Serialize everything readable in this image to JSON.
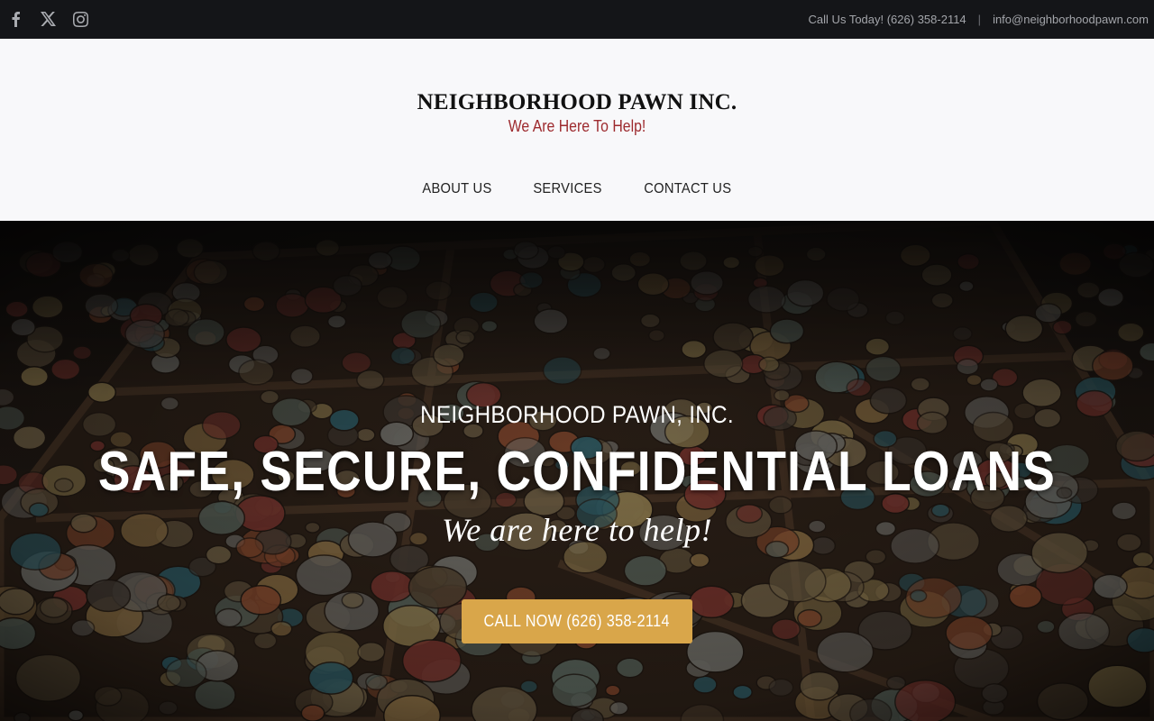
{
  "topbar": {
    "social": [
      {
        "name": "facebook-icon"
      },
      {
        "name": "x-twitter-icon"
      },
      {
        "name": "instagram-icon"
      }
    ],
    "phone_text": "Call Us Today! (626) 358-2114",
    "separator": "|",
    "email": "info@neighborhoodpawn.com"
  },
  "header": {
    "logo_name": "NEIGHBORHOOD PAWN INC.",
    "logo_tagline": "We Are Here To Help!",
    "nav": [
      "ABOUT US",
      "SERVICES",
      "CONTACT US"
    ]
  },
  "hero": {
    "eyebrow": "NEIGHBORHOOD PAWN, INC.",
    "headline": "SAFE, SECURE, CONFIDENTIAL LOANS",
    "subline": "We are here to help!",
    "cta_label": "CALL NOW (626) 358-2114",
    "colors": {
      "cta": "#d9a64a",
      "tagline": "#9d2a2e",
      "topbar": "#141518"
    }
  }
}
